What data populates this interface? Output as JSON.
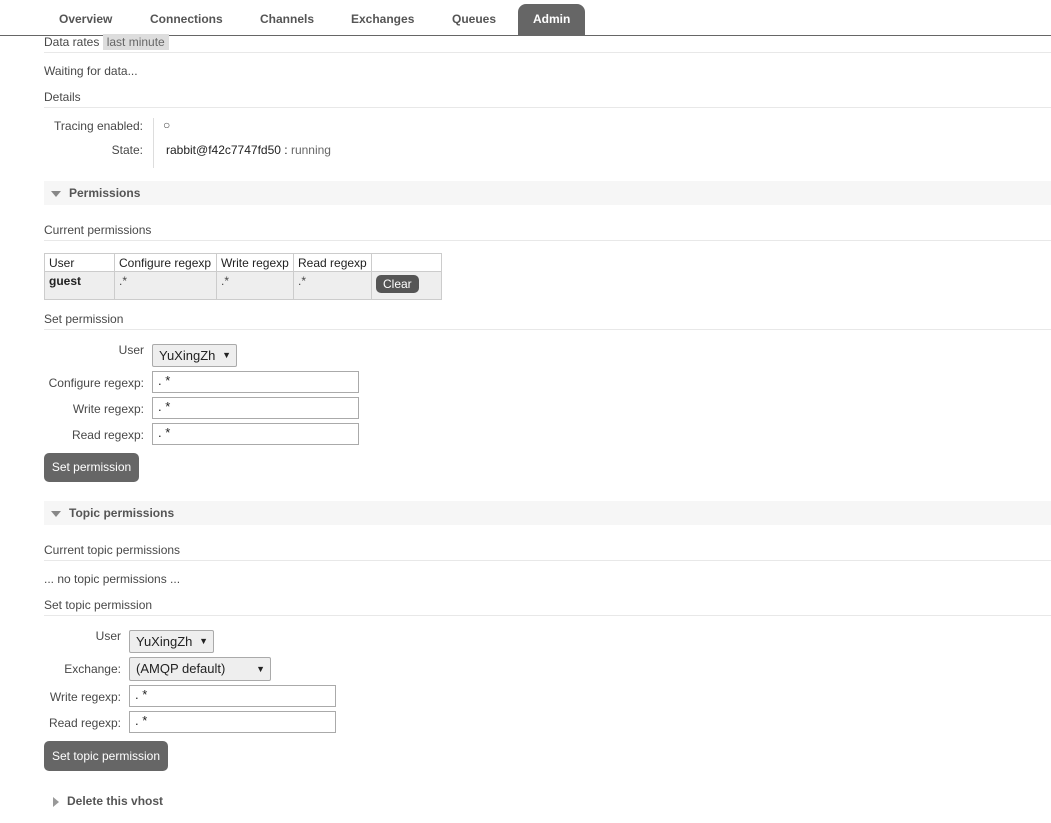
{
  "tabs": [
    "Overview",
    "Connections",
    "Channels",
    "Exchanges",
    "Queues",
    "Admin"
  ],
  "active_tab": "Admin",
  "data_rates": {
    "label": "Data rates",
    "range": "last minute"
  },
  "waiting_text": "Waiting for data...",
  "details": {
    "title": "Details",
    "tracing_label": "Tracing enabled:",
    "tracing_value": "○",
    "state_label": "State:",
    "state_node": "rabbit@f42c7747fd50 :",
    "state_value": "running"
  },
  "permissions": {
    "section_title": "Permissions",
    "current_title": "Current permissions",
    "columns": [
      "User",
      "Configure regexp",
      "Write regexp",
      "Read regexp",
      ""
    ],
    "rows": [
      {
        "user": "guest",
        "configure": ".*",
        "write": ".*",
        "read": ".*",
        "action": "Clear"
      }
    ],
    "set_title": "Set permission",
    "user_label": "User",
    "user_value": "YuXingZh",
    "configure_label": "Configure regexp:",
    "configure_value": ". *",
    "write_label": "Write regexp:",
    "write_value": ". *",
    "read_label": "Read regexp:",
    "read_value": ". *",
    "submit": "Set permission"
  },
  "topic_permissions": {
    "section_title": "Topic permissions",
    "current_title": "Current topic permissions",
    "empty_text": "... no topic permissions ...",
    "set_title": "Set topic permission",
    "user_label": "User",
    "user_value": "YuXingZh",
    "exchange_label": "Exchange:",
    "exchange_value": "(AMQP default)",
    "write_label": "Write regexp:",
    "write_value": ". *",
    "read_label": "Read regexp:",
    "read_value": ". *",
    "submit": "Set topic permission"
  },
  "delete_section": "Delete this vhost",
  "icons": {
    "dropdown": "caret-down-icon",
    "collapse": "triangle-down-icon",
    "expand": "triangle-right-icon"
  }
}
